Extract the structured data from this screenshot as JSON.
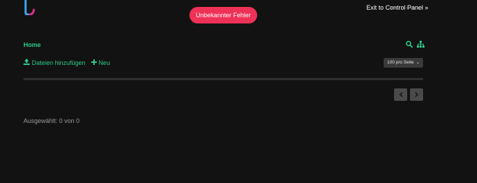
{
  "header": {
    "error_badge": "Unbekannter Fehler",
    "user_text": "· · · · · · · · ·",
    "exit_link": "Exit to Control Panel »"
  },
  "breadcrumb": {
    "home": "Home"
  },
  "toolbar": {
    "upload_label": "Dateien hinzufügen",
    "new_label": "Neu",
    "per_page": "100 pro Seite"
  },
  "footer": {
    "selected_text": "Ausgewählt: 0 von 0"
  },
  "icons": {
    "search": "search-icon",
    "sitemap": "sitemap-icon",
    "upload": "upload-icon",
    "plus": "plus-icon",
    "prev": "chevron-left-icon",
    "next": "chevron-right-icon"
  },
  "colors": {
    "background": "#121212",
    "accent": "#2ecc8a",
    "error": "#ee3156"
  }
}
